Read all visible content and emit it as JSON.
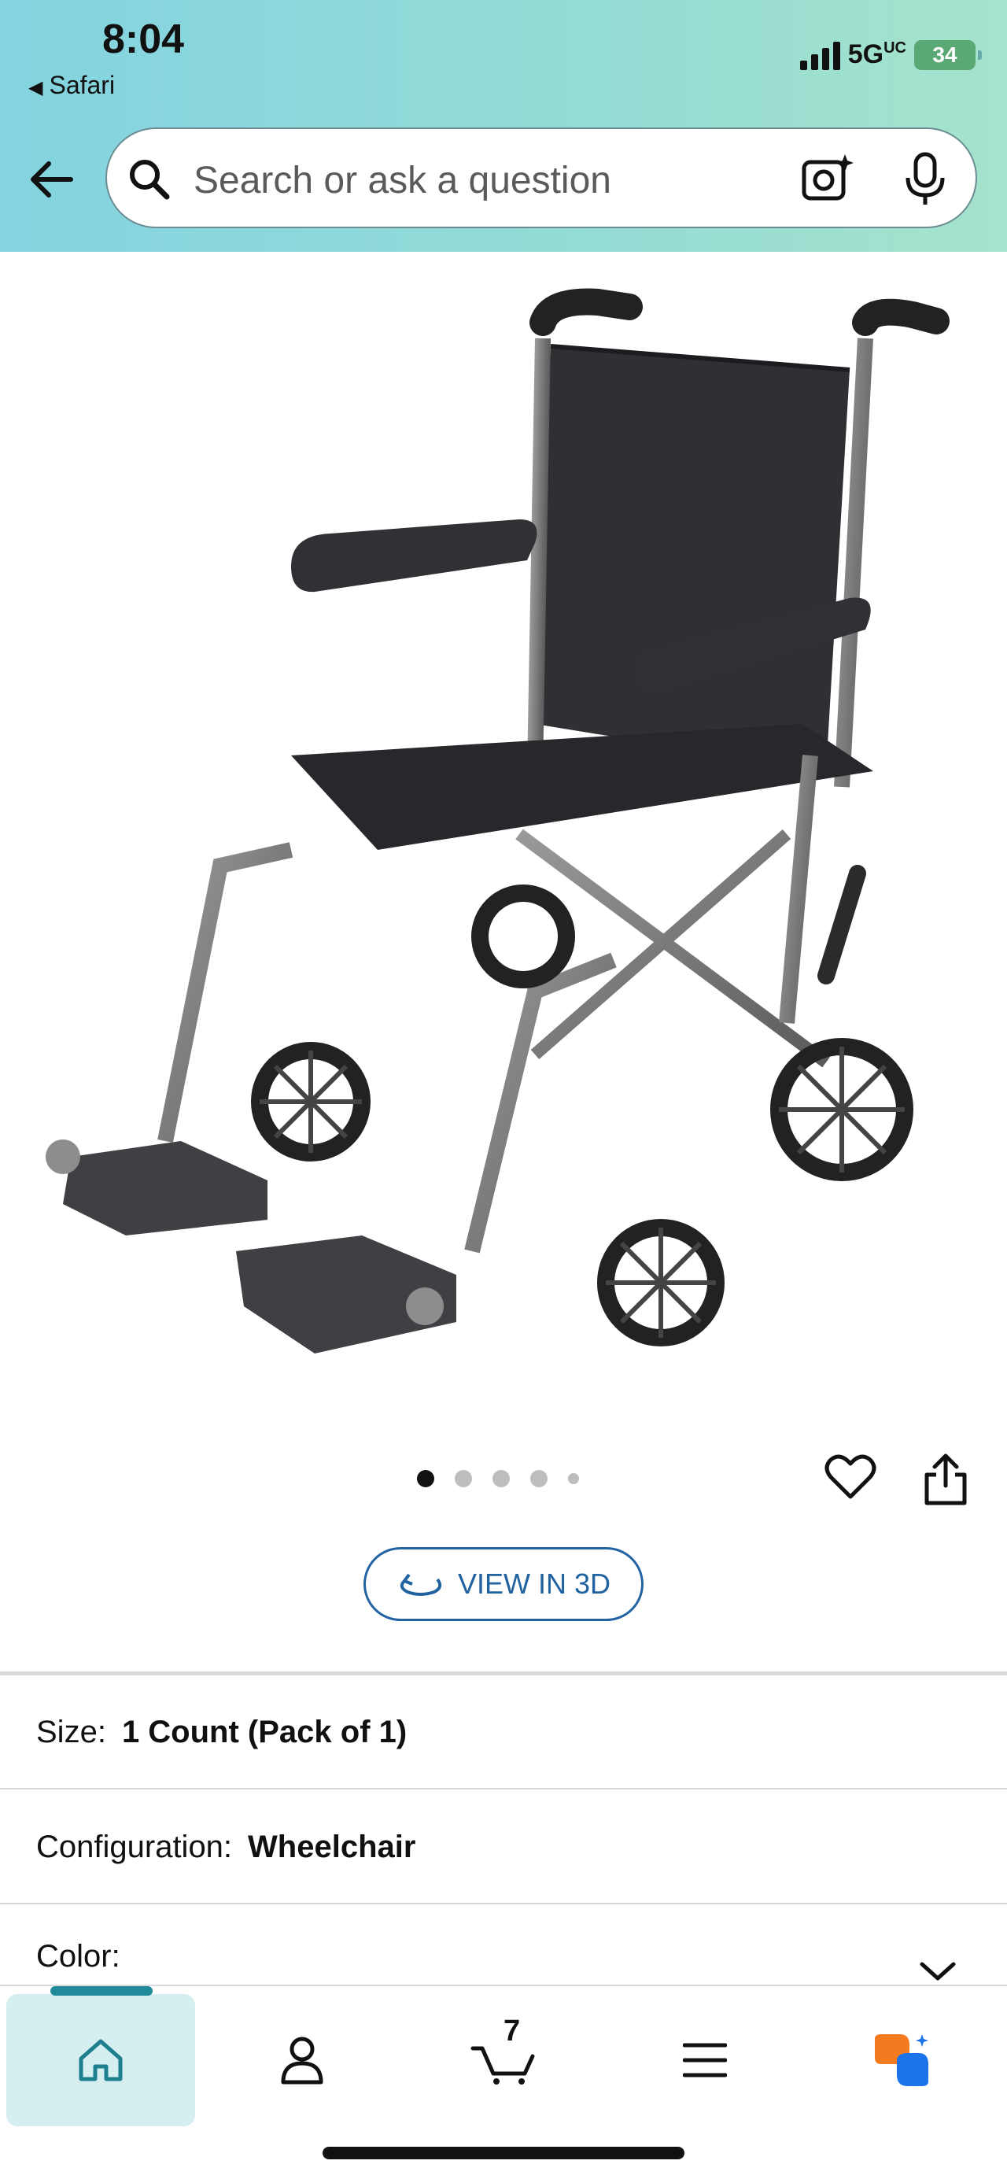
{
  "status_bar": {
    "time": "8:04",
    "back_app": "Safari",
    "network": "5G",
    "network_suffix": "UC",
    "battery": "34"
  },
  "search": {
    "placeholder": "Search or ask a question"
  },
  "carousel": {
    "total_dots": 5,
    "active_index": 0
  },
  "actions": {
    "view_3d_label": "VIEW IN 3D"
  },
  "options": {
    "size_label": "Size:",
    "size_value": "1 Count (Pack of 1)",
    "configuration_label": "Configuration:",
    "configuration_value": "Wheelchair",
    "color_label": "Color:"
  },
  "bottom_nav": {
    "cart_count": "7",
    "items": [
      "home",
      "profile",
      "cart",
      "menu",
      "rufus"
    ]
  },
  "colors": {
    "header_gradient_start": "#83d3e0",
    "header_gradient_end": "#a5e3cc",
    "link_blue": "#2162a1",
    "nav_active_bg": "#d5eef0",
    "nav_active_accent": "#1e8a9a"
  }
}
